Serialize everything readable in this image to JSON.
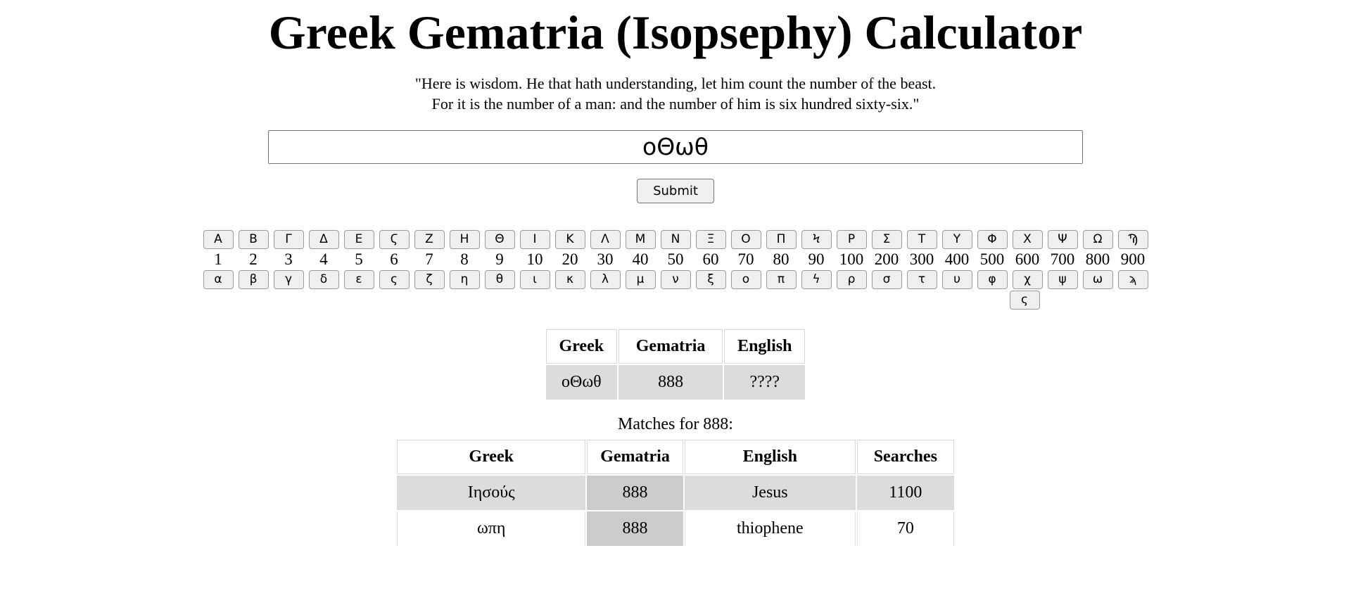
{
  "header": {
    "title": "Greek Gematria (Isopsephy) Calculator",
    "quote": "\"Here is wisdom. He that hath understanding, let him count the number of the beast.\nFor it is the number of a man: and the number of him is six hundred sixty-six.\""
  },
  "form": {
    "input_value": "οΘωθ",
    "input_placeholder": "",
    "submit_label": "Submit"
  },
  "keypad": {
    "uppercase": [
      "Α",
      "Β",
      "Γ",
      "Δ",
      "Ε",
      "Ϛ",
      "Ζ",
      "Η",
      "Θ",
      "Ι",
      "Κ",
      "Λ",
      "Μ",
      "Ν",
      "Ξ",
      "Ο",
      "Π",
      "Ϟ",
      "Ρ",
      "Σ",
      "Τ",
      "Υ",
      "Φ",
      "Χ",
      "Ψ",
      "Ω",
      "Ϡ"
    ],
    "values": [
      "1",
      "2",
      "3",
      "4",
      "5",
      "6",
      "7",
      "8",
      "9",
      "10",
      "20",
      "30",
      "40",
      "50",
      "60",
      "70",
      "80",
      "90",
      "100",
      "200",
      "300",
      "400",
      "500",
      "600",
      "700",
      "800",
      "900"
    ],
    "lowercase": [
      "α",
      "β",
      "γ",
      "δ",
      "ε",
      "ς",
      "ζ",
      "η",
      "θ",
      "ι",
      "κ",
      "λ",
      "μ",
      "ν",
      "ξ",
      "ο",
      "π",
      "ϟ",
      "ρ",
      "σ",
      "τ",
      "υ",
      "φ",
      "χ",
      "ψ",
      "ω",
      "ϡ"
    ],
    "extra_key": "ς"
  },
  "result": {
    "headers": [
      "Greek",
      "Gematria",
      "English"
    ],
    "row": [
      "οΘωθ",
      "888",
      "????"
    ]
  },
  "matches": {
    "label": "Matches for 888:",
    "headers": [
      "Greek",
      "Gematria",
      "English",
      "Searches"
    ],
    "rows": [
      {
        "greek": "Ιησούς",
        "gematria": "888",
        "english": "Jesus",
        "searches": "1100"
      },
      {
        "greek": "ωπη",
        "gematria": "888",
        "english": "thiophene",
        "searches": "70"
      }
    ]
  },
  "colors": {
    "page_background": "#ffffff",
    "text": "#000000",
    "key_background": "#efefef",
    "key_border": "#9b9b9b",
    "row_shaded": "#dcdcdc",
    "gematria_cell": "#cccccc",
    "input_border": "#767676"
  }
}
